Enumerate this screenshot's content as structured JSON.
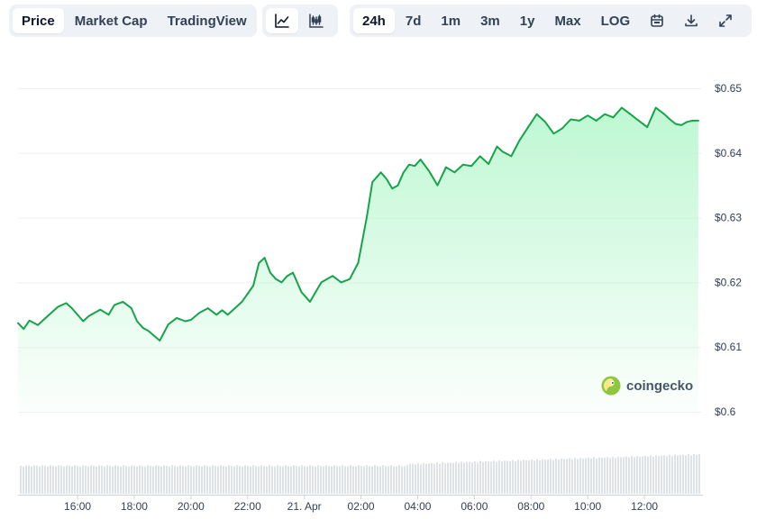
{
  "toolbar": {
    "tabs": [
      {
        "label": "Price",
        "active": true
      },
      {
        "label": "Market Cap",
        "active": false
      },
      {
        "label": "TradingView",
        "active": false
      }
    ],
    "chart_types": [
      {
        "icon": "line-chart-icon",
        "active": true
      },
      {
        "icon": "candlestick-chart-icon",
        "active": false
      }
    ],
    "ranges": [
      {
        "label": "24h",
        "active": true
      },
      {
        "label": "7d",
        "active": false
      },
      {
        "label": "1m",
        "active": false
      },
      {
        "label": "3m",
        "active": false
      },
      {
        "label": "1y",
        "active": false
      },
      {
        "label": "Max",
        "active": false
      },
      {
        "label": "LOG",
        "active": false
      }
    ],
    "tools": [
      "calendar-icon",
      "download-icon",
      "expand-icon"
    ]
  },
  "watermark": {
    "text": "coingecko"
  },
  "colors": {
    "line": "#16a34a",
    "fill_top": "#bbf7d0",
    "volume": "#dfe3e8",
    "grid": "#eef0f3"
  },
  "chart_data": {
    "type": "area",
    "title": "",
    "xlabel": "",
    "ylabel": "",
    "ylim": [
      0.6,
      0.65
    ],
    "yticks": [
      "$0.6",
      "$0.61",
      "$0.62",
      "$0.63",
      "$0.64",
      "$0.65"
    ],
    "xticks": [
      {
        "label": "16:00",
        "h": 2
      },
      {
        "label": "18:00",
        "h": 4
      },
      {
        "label": "20:00",
        "h": 6
      },
      {
        "label": "22:00",
        "h": 8
      },
      {
        "label": "21. Apr",
        "h": 10
      },
      {
        "label": "02:00",
        "h": 12
      },
      {
        "label": "04:00",
        "h": 14
      },
      {
        "label": "06:00",
        "h": 16
      },
      {
        "label": "08:00",
        "h": 18
      },
      {
        "label": "10:00",
        "h": 20
      },
      {
        "label": "12:00",
        "h": 22
      }
    ],
    "x_range_hours": [
      -0.1,
      24
    ],
    "grid": true,
    "series": [
      {
        "h": [
          -0.1,
          0.1,
          0.3,
          0.6,
          1.0,
          1.3,
          1.6,
          1.8,
          2.2,
          2.4,
          2.8,
          3.1,
          3.3,
          3.6,
          3.9,
          4.1,
          4.3,
          4.5,
          4.9,
          5.2,
          5.5,
          5.8,
          6.0,
          6.3,
          6.6,
          6.9,
          7.1,
          7.3,
          7.5,
          7.8,
          8.2,
          8.4,
          8.6,
          8.8,
          9.0,
          9.2,
          9.4,
          9.6,
          9.9,
          10.2,
          10.4,
          10.6,
          10.8,
          11.0,
          11.3,
          11.6,
          11.9,
          12.2,
          12.4,
          12.7,
          12.9,
          13.1,
          13.3,
          13.5,
          13.7,
          13.9,
          14.1,
          14.4,
          14.7,
          15.0,
          15.3,
          15.6,
          15.9,
          16.2,
          16.5,
          16.8,
          17.0,
          17.3,
          17.6,
          17.9,
          18.2,
          18.5,
          18.8,
          19.1,
          19.4,
          19.7,
          20.0,
          20.3,
          20.6,
          20.9,
          21.2,
          21.5,
          21.8,
          22.1,
          22.4,
          22.7,
          22.9,
          23.1,
          23.3,
          23.5,
          23.7,
          23.9
        ],
        "price": [
          0.6137,
          0.6128,
          0.6141,
          0.6134,
          0.615,
          0.6162,
          0.6168,
          0.616,
          0.614,
          0.6148,
          0.6158,
          0.615,
          0.6165,
          0.617,
          0.616,
          0.614,
          0.613,
          0.6125,
          0.611,
          0.6135,
          0.6145,
          0.614,
          0.6142,
          0.6153,
          0.616,
          0.615,
          0.6157,
          0.615,
          0.6158,
          0.617,
          0.6195,
          0.623,
          0.6238,
          0.6215,
          0.6205,
          0.62,
          0.621,
          0.6215,
          0.6185,
          0.617,
          0.6185,
          0.62,
          0.6205,
          0.621,
          0.62,
          0.6205,
          0.623,
          0.63,
          0.6355,
          0.637,
          0.636,
          0.6345,
          0.635,
          0.637,
          0.6382,
          0.638,
          0.639,
          0.6372,
          0.635,
          0.6378,
          0.637,
          0.6382,
          0.638,
          0.6395,
          0.6383,
          0.641,
          0.6402,
          0.6395,
          0.642,
          0.644,
          0.646,
          0.6448,
          0.643,
          0.6438,
          0.6452,
          0.645,
          0.6458,
          0.645,
          0.646,
          0.6455,
          0.647,
          0.646,
          0.645,
          0.644,
          0.647,
          0.646,
          0.6452,
          0.6445,
          0.6443,
          0.6448,
          0.645,
          0.645
        ]
      }
    ]
  }
}
